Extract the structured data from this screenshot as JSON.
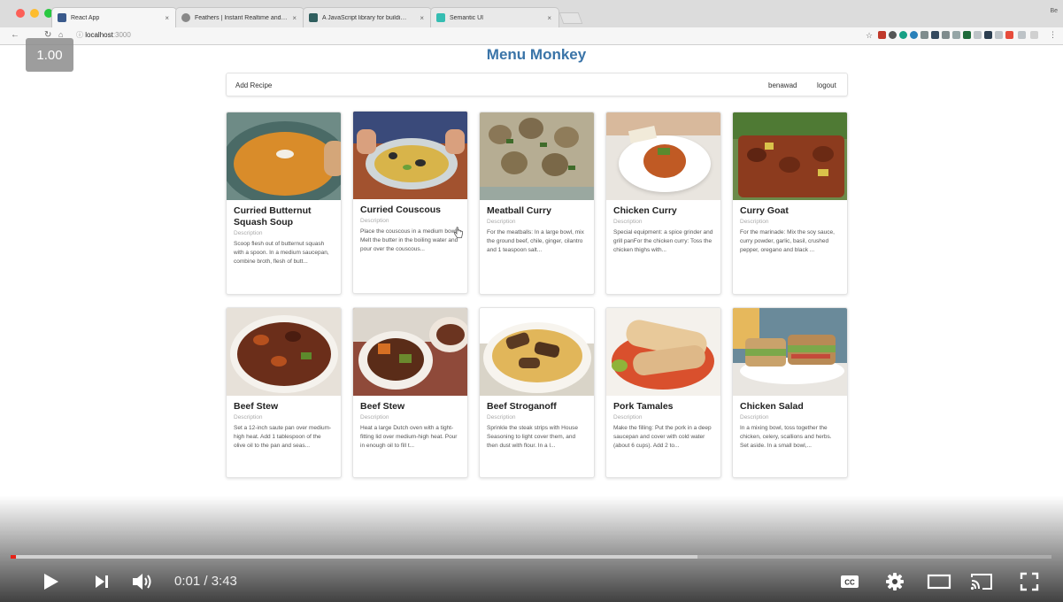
{
  "browser": {
    "tabs": [
      {
        "title": "React App",
        "close": "×",
        "favicon_color": "#3a5a8c",
        "active": true
      },
      {
        "title": "Feathers | Instant Realtime and…",
        "close": "×",
        "favicon_color": "#888888",
        "active": false
      },
      {
        "title": "A JavaScript library for buildi…",
        "close": "×",
        "favicon_color": "#2f5e5e",
        "active": false
      },
      {
        "title": "Semantic UI",
        "close": "×",
        "favicon_color": "#35bdb2",
        "active": false
      }
    ],
    "profile_label": "Be",
    "url_host": "localhost",
    "url_port": ":3000"
  },
  "player_overlay": {
    "speed": "1.00"
  },
  "app": {
    "title": "Menu Monkey",
    "menu": {
      "add_recipe": "Add Recipe",
      "username": "benawad",
      "logout": "logout"
    },
    "recipes": [
      {
        "name": "Curried Butternut Squash Soup",
        "meta": "Description",
        "desc": "Scoop flesh out of butternut squash with a spoon. In a medium saucepan, combine broth, flesh of butt..."
      },
      {
        "name": "Curried Couscous",
        "meta": "Description",
        "desc": "Place the couscous in a medium bowl. Melt the butter in the boiling water and pour over the couscous..."
      },
      {
        "name": "Meatball Curry",
        "meta": "Description",
        "desc": "For the meatballs: In a large bowl, mix the ground beef, chile, ginger, cilantro and 1 teaspoon salt..."
      },
      {
        "name": "Chicken Curry",
        "meta": "Description",
        "desc": "Special equipment: a spice grinder and grill panFor the chicken curry: Toss the chicken thighs with..."
      },
      {
        "name": "Curry Goat",
        "meta": "Description",
        "desc": "For the marinade: Mix the soy sauce, curry powder, garlic, basil, crushed pepper, oregano and black ..."
      },
      {
        "name": "Beef Stew",
        "meta": "Description",
        "desc": "Set a 12-inch saute pan over medium-high heat. Add 1 tablespoon of the olive oil to the pan and seas..."
      },
      {
        "name": "Beef Stew",
        "meta": "Description",
        "desc": "Heat a large Dutch oven with a tight-fitting lid over medium-high heat. Pour in enough oil to fill t..."
      },
      {
        "name": "Beef Stroganoff",
        "meta": "Description",
        "desc": "Sprinkle the steak strips with House Seasoning to light cover them, and then dust with flour. In a l..."
      },
      {
        "name": "Pork Tamales",
        "meta": "Description",
        "desc": "Make the filling: Put the pork in a deep saucepan and cover with cold water (about 6 cups). Add 2 to..."
      },
      {
        "name": "Chicken Salad",
        "meta": "Description",
        "desc": "In a mixing bowl, toss together the chicken, celery, scallions and herbs. Set aside. In a small bowl,..."
      }
    ]
  },
  "video": {
    "time": "0:01 / 3:43",
    "played_fraction": 0.005,
    "buffered_fraction": 0.66,
    "accent": "#e62117"
  }
}
